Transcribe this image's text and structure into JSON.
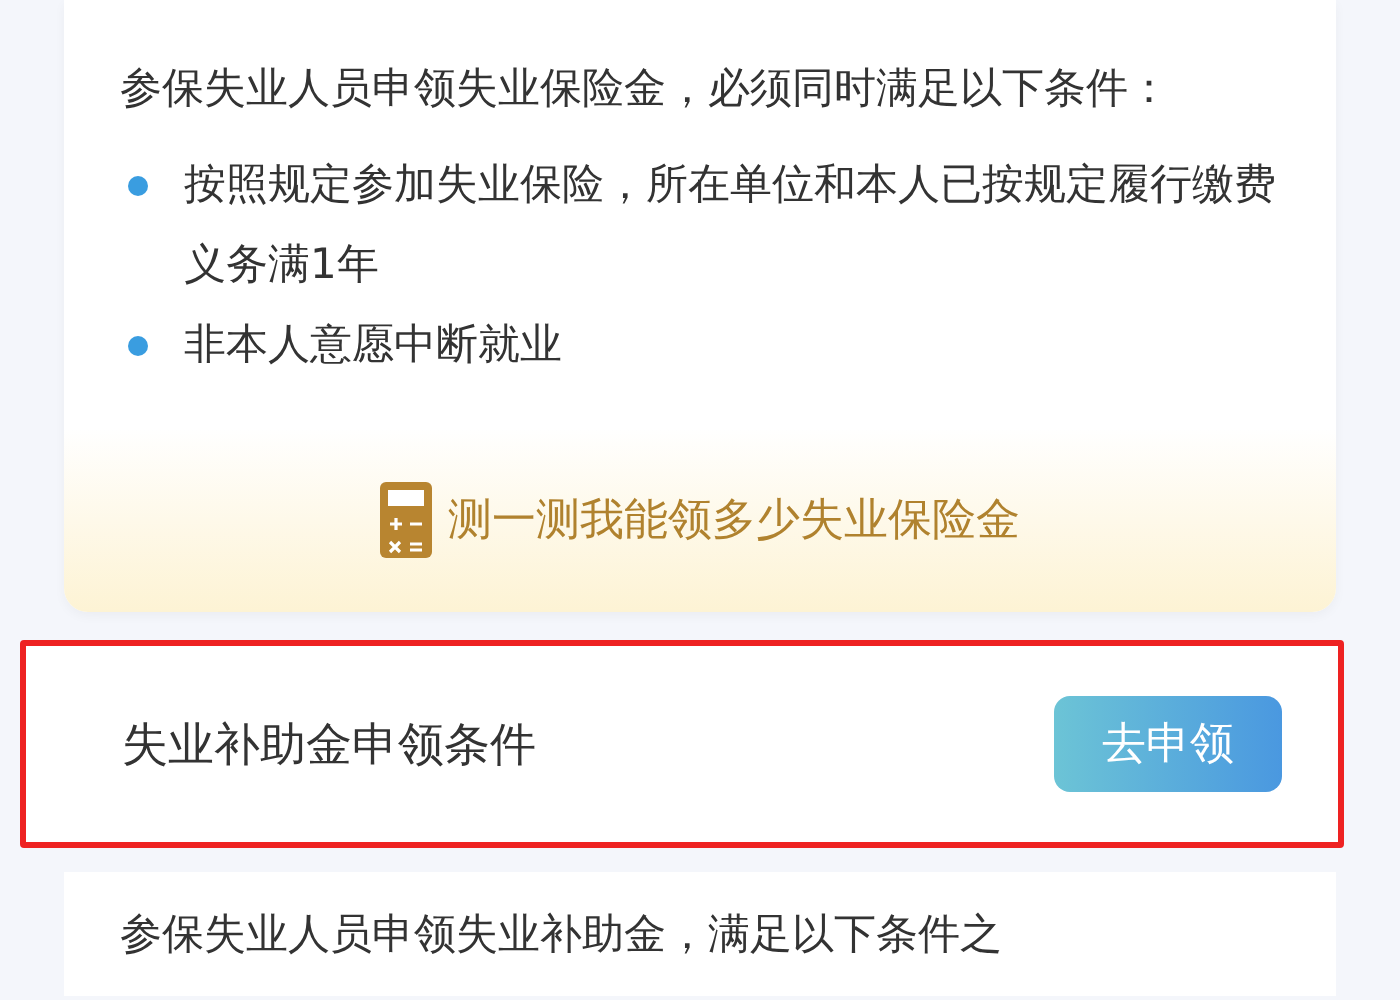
{
  "insurance_card": {
    "intro": "参保失业人员申领失业保险金，必须同时满足以下条件：",
    "conditions": [
      "按照规定参加失业保险，所在单位和本人已按规定履行缴费义务满1年",
      "非本人意愿中断就业"
    ],
    "calculator_link": "测一测我能领多少失业保险金"
  },
  "subsidy_section": {
    "title": "失业补助金申领条件",
    "apply_button": "去申领",
    "highlighted": true,
    "intro": "参保失业人员申领失业补助金，满足以下条件之"
  }
}
